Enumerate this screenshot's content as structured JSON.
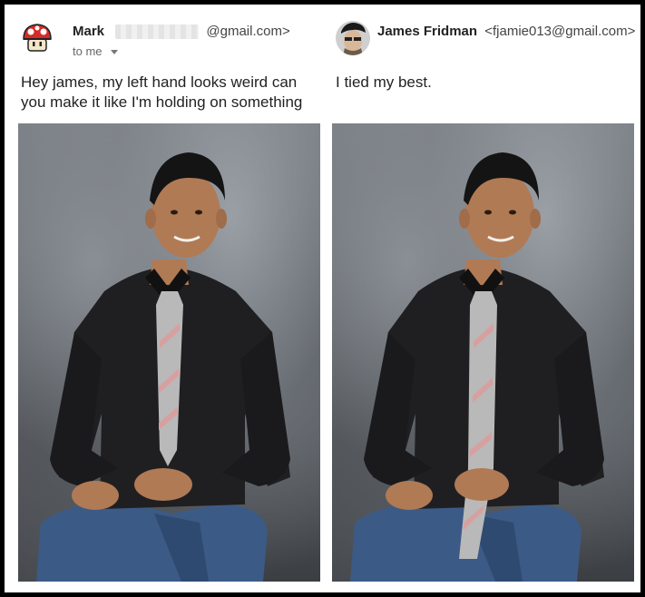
{
  "left_email": {
    "sender_name": "Mark",
    "sender_email_suffix": "@gmail.com>",
    "recipient": "to me",
    "message": "Hey james, my left hand looks weird can you make it like I'm holding on something",
    "avatar_icon": "red-mushroom-icon"
  },
  "right_email": {
    "sender_name": "James Fridman",
    "sender_email": "<fjamie013@gmail.com>",
    "message": "I tied my best.",
    "avatar_icon": "person-avatar-icon"
  },
  "colors": {
    "shirt": "#1f1f21",
    "tie": "#b9b9b9",
    "jeans": "#3c5a86",
    "skin": "#b07a55",
    "stool": "#d98a5e",
    "mushroom_red": "#d42a2a"
  }
}
